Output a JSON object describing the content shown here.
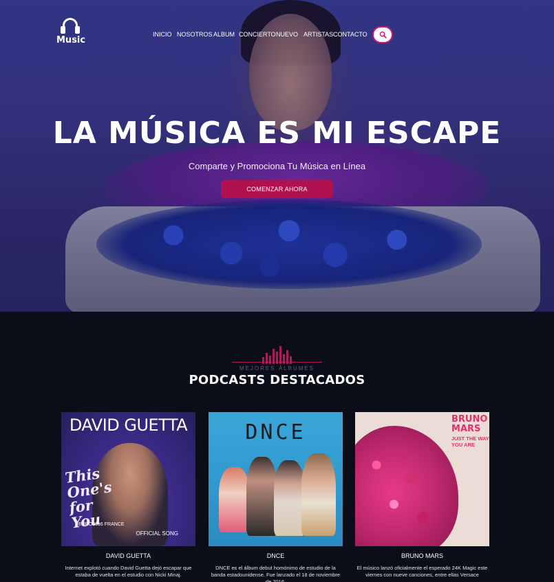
{
  "brand": {
    "name": "Music",
    "accent": "#b0124f",
    "accent_border": "#d01870"
  },
  "nav": {
    "items": [
      {
        "label": "INICIO",
        "key": "inicio"
      },
      {
        "label": "NOSOTROS",
        "key": "nosotros"
      },
      {
        "label": "ALBUM",
        "key": "album"
      },
      {
        "label": "CONCIERTO",
        "key": "concierto"
      },
      {
        "label": "NUEVO",
        "key": "nuevo"
      },
      {
        "label": "ARTISTAS",
        "key": "artistas"
      },
      {
        "label": "CONTACTO",
        "key": "contacto"
      }
    ],
    "search_icon": "search-icon"
  },
  "hero": {
    "title": "La Música Es Mi Escape",
    "subtitle": "Comparte y Promociona Tu Música en Línea",
    "cta_label": "COMENZAR AHORA"
  },
  "section": {
    "kicker": "MEJORES ÁLBUMES",
    "title": "PODCASTS DESTACADOS"
  },
  "albums": [
    {
      "artist": "DAVID GUETTA",
      "description": "Internet explotó cuando David Guetta dejó escapar que estaba de vuelta en el estudio con Nicki Minaj.",
      "cover": {
        "top_text": "DAVID GUETTA",
        "slogan": "This One's for You",
        "badge": "EURO2016 FRANCE",
        "footer": "OFFICIAL SONG"
      }
    },
    {
      "artist": "DNCE",
      "description": "DNCE es el álbum debut homónimo de estudio de la banda estadounidense. Fue lanzado el 18 de noviembre de 2016.",
      "cover": {
        "top_text": "DNCE"
      }
    },
    {
      "artist": "BRUNO MARS",
      "description": "El músico lanzó oficialmente el esperado 24K Magic este viernes con nueve canciones, entre ellas Versace",
      "cover": {
        "top_text": "BRUNO MARS",
        "subtitle": "JUST THE WAY YOU ARE"
      }
    }
  ]
}
